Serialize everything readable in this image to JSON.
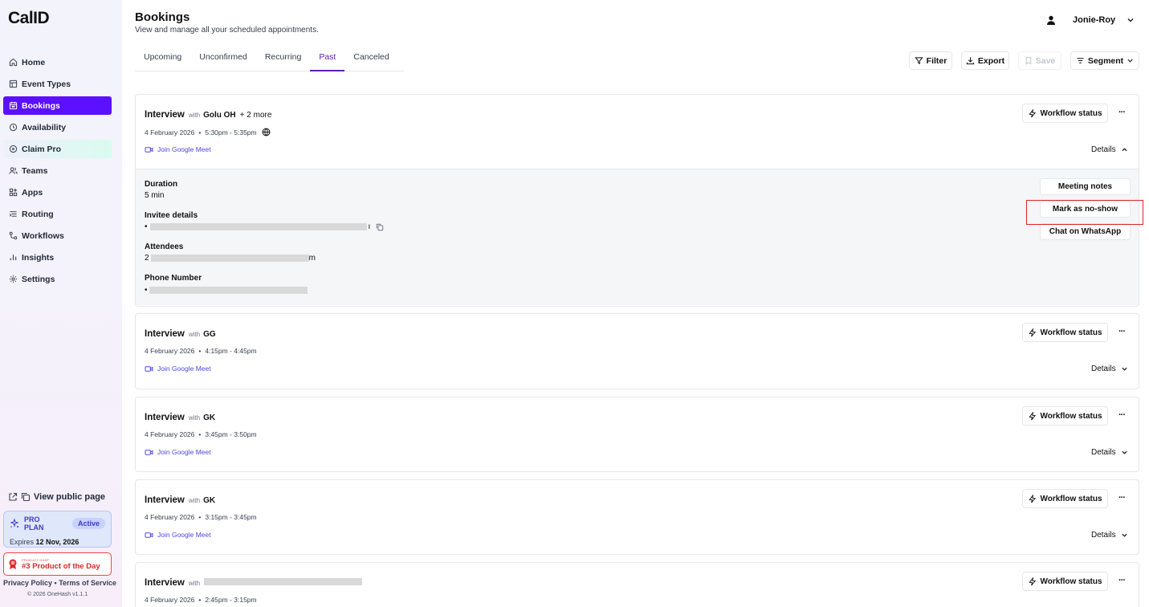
{
  "app": {
    "logo": "CalID"
  },
  "sidebar": {
    "items": [
      {
        "label": "Home",
        "icon": "home-icon"
      },
      {
        "label": "Event Types",
        "icon": "event-types-icon"
      },
      {
        "label": "Bookings",
        "icon": "calendar-icon",
        "active": true
      },
      {
        "label": "Availability",
        "icon": "clock-icon"
      },
      {
        "label": "Claim Pro",
        "icon": "claim-pro-icon"
      },
      {
        "label": "Teams",
        "icon": "users-icon"
      },
      {
        "label": "Apps",
        "icon": "apps-icon"
      },
      {
        "label": "Routing",
        "icon": "routing-icon"
      },
      {
        "label": "Workflows",
        "icon": "workflows-icon"
      },
      {
        "label": "Insights",
        "icon": "insights-icon"
      },
      {
        "label": "Settings",
        "icon": "settings-icon"
      }
    ],
    "view_public": "View public page",
    "plan": {
      "name": "PRO PLAN",
      "status": "Active",
      "expires_label": "Expires",
      "expires_date": "12 Nov, 2026"
    },
    "product_hunt": {
      "small": "PRODUCT HUNT",
      "label": "#3 Product of the Day"
    },
    "footer_links": "Privacy Policy • Terms of Service",
    "copyright": "© 2026 OneHash v1.1.1"
  },
  "header": {
    "title": "Bookings",
    "subtitle": "View and manage all your scheduled appointments.",
    "user_name": "Jonie-Roy"
  },
  "tabs": [
    {
      "label": "Upcoming"
    },
    {
      "label": "Unconfirmed"
    },
    {
      "label": "Recurring"
    },
    {
      "label": "Past",
      "active": true
    },
    {
      "label": "Canceled"
    }
  ],
  "toolbar": {
    "filter": "Filter",
    "export": "Export",
    "save": "Save",
    "segment": "Segment"
  },
  "bookings": [
    {
      "title": "Interview",
      "with": "with",
      "name": "Golu OH",
      "more": "+ 2 more",
      "date": "4 February 2026",
      "time": "5:30pm - 5:35pm",
      "meet": "Join Google Meet",
      "workflow": "Workflow status",
      "details": "Details",
      "expanded": true
    },
    {
      "title": "Interview",
      "with": "with",
      "name": "GG",
      "date": "4 February 2026",
      "time": "4:15pm - 4:45pm",
      "meet": "Join Google Meet",
      "workflow": "Workflow status",
      "details": "Details"
    },
    {
      "title": "Interview",
      "with": "with",
      "name": "GK",
      "date": "4 February 2026",
      "time": "3:45pm - 3:50pm",
      "meet": "Join Google Meet",
      "workflow": "Workflow status",
      "details": "Details"
    },
    {
      "title": "Interview",
      "with": "with",
      "name": "GK",
      "date": "4 February 2026",
      "time": "3:15pm - 3:45pm",
      "meet": "Join Google Meet",
      "workflow": "Workflow status",
      "details": "Details"
    },
    {
      "title": "Interview",
      "with": "with",
      "name": "",
      "date": "4 February 2026",
      "time": "2:45pm - 3:15pm",
      "workflow": "Workflow status"
    }
  ],
  "booking_details": {
    "duration_label": "Duration",
    "duration_value": "5 min",
    "invitee_label": "Invitee details",
    "invitee_prefix": "•",
    "invitee_suffix": "ı",
    "attendees_label": "Attendees",
    "attendees_prefix": "2",
    "attendees_suffix": "m",
    "phone_label": "Phone Number",
    "phone_prefix": "•",
    "actions": {
      "meeting_notes": "Meeting notes",
      "mark_no_show": "Mark as no-show",
      "chat_whatsapp": "Chat on WhatsApp"
    }
  },
  "colors": {
    "accent": "#5b10ff",
    "link": "#4f46e5",
    "highlight": "#dc2626"
  }
}
